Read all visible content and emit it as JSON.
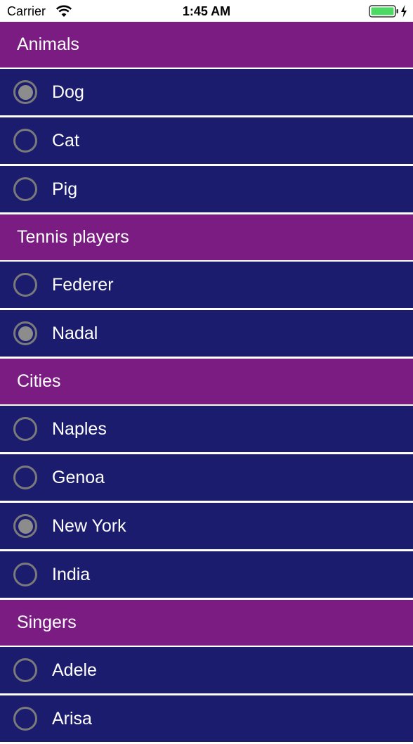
{
  "status_bar": {
    "carrier": "Carrier",
    "time": "1:45 AM",
    "wifi_icon": "wifi-icon",
    "battery_icon": "battery-icon",
    "charge_icon": "charging-bolt-icon",
    "battery_color": "#4cd964"
  },
  "colors": {
    "section_header": "#7b1c83",
    "row_background": "#1b1c6e",
    "separator": "#ffffff",
    "radio_border": "#7a7a7a",
    "radio_fill": "#8c8c8c"
  },
  "sections": [
    {
      "title": "Animals",
      "items": [
        {
          "label": "Dog",
          "selected": true
        },
        {
          "label": "Cat",
          "selected": false
        },
        {
          "label": "Pig",
          "selected": false
        }
      ]
    },
    {
      "title": "Tennis players",
      "items": [
        {
          "label": "Federer",
          "selected": false
        },
        {
          "label": "Nadal",
          "selected": true
        }
      ]
    },
    {
      "title": "Cities",
      "items": [
        {
          "label": "Naples",
          "selected": false
        },
        {
          "label": "Genoa",
          "selected": false
        },
        {
          "label": "New York",
          "selected": true
        },
        {
          "label": "India",
          "selected": false
        }
      ]
    },
    {
      "title": "Singers",
      "items": [
        {
          "label": "Adele",
          "selected": false
        },
        {
          "label": "Arisa",
          "selected": false
        }
      ]
    }
  ]
}
